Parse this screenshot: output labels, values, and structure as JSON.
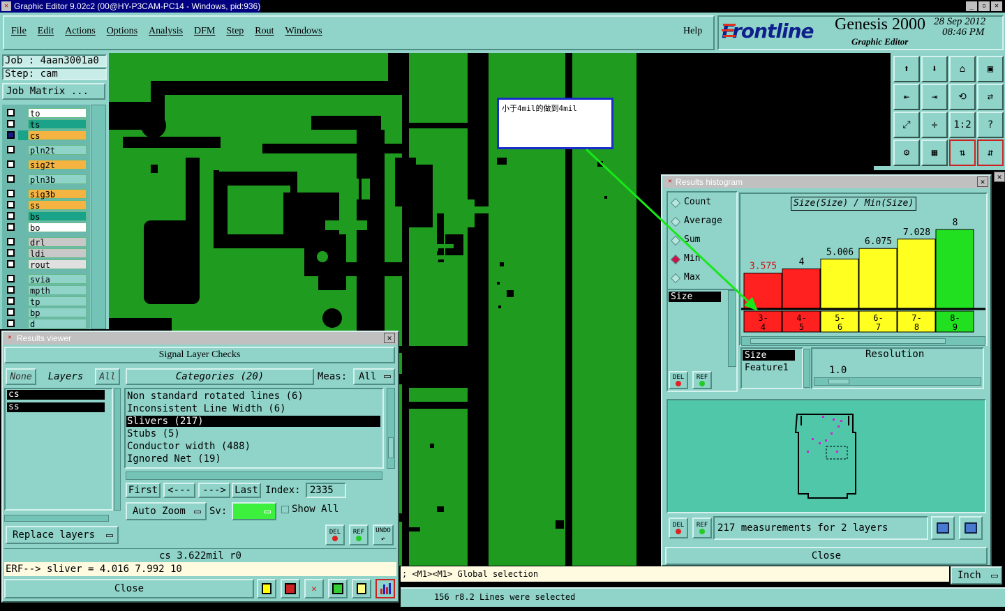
{
  "window": {
    "title": "Graphic Editor 9.02c2 (00@HY-P3CAM-PC14 - Windows, pid:936)"
  },
  "menu": {
    "items": [
      "File",
      "Edit",
      "Actions",
      "Options",
      "Analysis",
      "DFM",
      "Step",
      "Rout",
      "Windows"
    ],
    "help": "Help"
  },
  "brand": {
    "logo": "Frontline",
    "product": "Genesis 2000",
    "subtitle": "Graphic Editor",
    "date": "28 Sep 2012",
    "time": "08:46 PM"
  },
  "job": {
    "job_line": "Job : 4aan3001a0",
    "step_line": "Step: cam",
    "matrix_button": "Job Matrix ..."
  },
  "layers": [
    {
      "name": "to",
      "color": "#ffffff"
    },
    {
      "name": "ts",
      "color": "#1aa389"
    },
    {
      "name": "cs",
      "color": "#f5b342"
    },
    {
      "name": "pln2t",
      "color": "#8fd3c9"
    },
    {
      "name": "sig2t",
      "color": "#f5b342"
    },
    {
      "name": "pln3b",
      "color": "#8fd3c9"
    },
    {
      "name": "sig3b",
      "color": "#f5b342"
    },
    {
      "name": "ss",
      "color": "#f5b342"
    },
    {
      "name": "bs",
      "color": "#1aa389"
    },
    {
      "name": "bo",
      "color": "#ffffff"
    },
    {
      "name": "drl",
      "color": "#c8c8c8"
    },
    {
      "name": "ldi",
      "color": "#c8c8c8"
    },
    {
      "name": "rout",
      "color": "#e0e0e0"
    },
    {
      "name": "svia",
      "color": "#8fd3c9"
    },
    {
      "name": "mpth",
      "color": "#8fd3c9"
    },
    {
      "name": "tp",
      "color": "#8fd3c9"
    },
    {
      "name": "bp",
      "color": "#8fd3c9"
    },
    {
      "name": "d",
      "color": "#8fd3c9"
    }
  ],
  "note": {
    "text": "小于4mil的做到4mil"
  },
  "results_viewer": {
    "title": "Results viewer",
    "header": "Signal Layer Checks",
    "none_btn": "None",
    "layers_label": "Layers",
    "all_btn": "All",
    "layer_list": [
      "cs",
      "ss"
    ],
    "categories_label": "Categories (20)",
    "meas_label": "Meas:",
    "meas_value": "All",
    "categories": [
      "Non standard rotated lines (6)",
      "Inconsistent Line Width (6)",
      "Slivers (217)",
      "Stubs (5)",
      "Conductor width (488)",
      "Ignored Net (19)"
    ],
    "selected_category": "Slivers (217)",
    "nav": {
      "first": "First",
      "prev": "<---",
      "next": "--->",
      "last": "Last",
      "index_label": "Index:",
      "index_value": "2335"
    },
    "auto_zoom": "Auto Zoom",
    "sv_label": "Sv:",
    "show_all": "Show All",
    "replace_layers": "Replace layers",
    "del": "DEL",
    "ref": "REF",
    "undo": "UNDO",
    "status": "cs 3.622mil  r0",
    "erf": "ERF--> sliver = 4.016 7.992 10",
    "close": "Close"
  },
  "histogram": {
    "title": "Results histogram",
    "modes": [
      {
        "label": "Count",
        "selected": false
      },
      {
        "label": "Average",
        "selected": false
      },
      {
        "label": "Sum",
        "selected": false
      },
      {
        "label": "Min",
        "selected": true
      },
      {
        "label": "Max",
        "selected": false
      }
    ],
    "attr_list": [
      "Size"
    ],
    "chart_title": "Size(Size) / Min(Size)",
    "size_label": "Size",
    "feature_label": "Feature1",
    "resolution_label": "Resolution",
    "resolution_value": "1.0",
    "summary": "217 measurements for 2 layers",
    "close": "Close",
    "del": "DEL",
    "ref": "REF"
  },
  "chart_data": {
    "type": "bar",
    "title": "Size(Size) / Min(Size)",
    "categories": [
      "3-4",
      "4-5",
      "5-6",
      "6-7",
      "7-8",
      "8-9"
    ],
    "values": [
      3.575,
      4,
      5.006,
      6.075,
      7.028,
      8
    ],
    "value_labels": [
      "3.575",
      "4",
      "5.006",
      "6.075",
      "7.028",
      "8"
    ],
    "colors": [
      "#ff2020",
      "#ff2020",
      "#ffff20",
      "#ffff20",
      "#ffff20",
      "#20e020"
    ],
    "ylim": [
      0,
      8.5
    ]
  },
  "bottom": {
    "message": "; <M1><M1> Global selection",
    "units": "Inch",
    "status": "156 r8.2 Lines were selected"
  }
}
